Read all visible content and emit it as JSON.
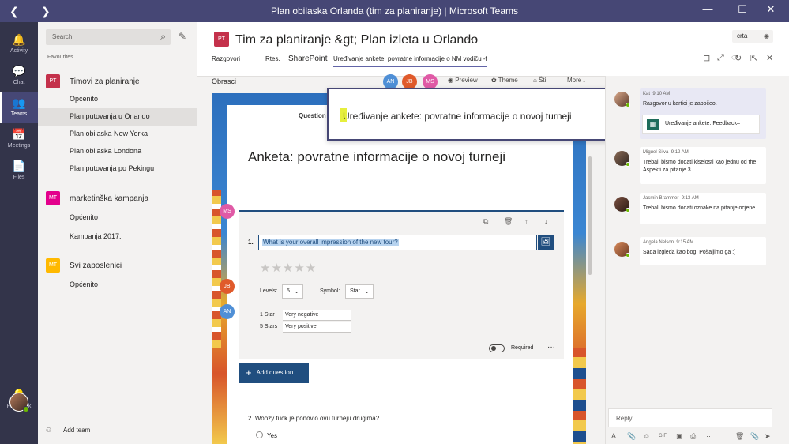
{
  "window": {
    "title": "Plan obilaska Orlanda (tim za planiranje) | Microsoft Teams",
    "back_glyph": "❮",
    "forward_glyph": "❯",
    "minimize": "—",
    "maximize": "☐",
    "close": "✕"
  },
  "rail": [
    {
      "label": "Activity",
      "icon": "bell-icon",
      "glyph": "🔔"
    },
    {
      "label": "Chat",
      "icon": "chat-icon",
      "glyph": "💬"
    },
    {
      "label": "Teams",
      "icon": "teams-icon",
      "glyph": "👥",
      "active": true
    },
    {
      "label": "Meetings",
      "icon": "calendar-icon",
      "glyph": "📅"
    },
    {
      "label": "Files",
      "icon": "files-icon",
      "glyph": "📄"
    },
    {
      "label": "Feedback",
      "icon": "lightbulb-icon",
      "glyph": "💡"
    }
  ],
  "sidebar": {
    "search_placeholder": "Search",
    "search_glyph": "⌕",
    "compose_glyph": "✎",
    "favourites_label": "Favourites",
    "teams": [
      {
        "tile": "PT",
        "color": "#c4314b",
        "name": "Timovi za planiranje",
        "channels": [
          "Općenito",
          "Plan putovanja u Orlando",
          "Plan obilaska New Yorka",
          "Plan obilaska Londona",
          "Plan putovanja po Pekingu"
        ]
      },
      {
        "tile": "MT",
        "color": "#e3008c",
        "name": "marketinška kampanja",
        "channels": [
          "Općenito",
          "Kampanja 2017."
        ]
      },
      {
        "tile": "MT",
        "color": "#ffb900",
        "name": "Svi zaposlenici",
        "channels": [
          "Općenito"
        ]
      }
    ],
    "add_team": "Add team",
    "add_team_glyph": "⚇"
  },
  "header": {
    "tile": "PT",
    "title": "Tim za planiranje &gt; Plan izleta u Orlando",
    "more": "···",
    "org_pill": "crta I",
    "org_glyph": "◉",
    "tabs": [
      "Razgovori",
      "Rtes.",
      "SharePoint",
      "Uređivanje ankete: povratne informacije o NM vodiču -f"
    ],
    "icons": [
      "⊟",
      "⤢",
      "◌",
      "↻",
      "⇱",
      "✕"
    ]
  },
  "forms": {
    "label": "Obrasci",
    "faces": [
      {
        "initials": "AN",
        "color": "#4f8fd6"
      },
      {
        "initials": "JB",
        "color": "#e05a2b"
      },
      {
        "initials": "MS",
        "color": "#e05aa6"
      }
    ],
    "preview": "Preview",
    "theme": "Theme",
    "share": "Šti",
    "more": "More",
    "preview_glyph": "◉",
    "theme_glyph": "✿",
    "share_glyph": "⌂",
    "more_glyph": "⌄",
    "questions_tab": "Question",
    "title": "Anketa: povratne informacije o novoj turneji",
    "side_faces": [
      {
        "initials": "MS",
        "color": "#e05aa6"
      },
      {
        "initials": "JB",
        "color": "#e05a2b"
      },
      {
        "initials": "AN",
        "color": "#4f8fd6"
      }
    ],
    "q1": {
      "number": "1.",
      "text": "What is your overall impression of the new tour?",
      "image_glyph": "🖼",
      "actions": [
        "⧉",
        "🗑",
        "↑",
        "↓"
      ],
      "stars": "★★★★★",
      "levels_label": "Levels:",
      "levels_value": "5",
      "symbol_label": "Symbol:",
      "symbol_value": "Star",
      "chevron": "⌄",
      "rows": [
        {
          "key": "1 Star",
          "value": "Very negative"
        },
        {
          "key": "5 Stars",
          "value": "Very positive"
        }
      ],
      "required_label": "Required",
      "more": "···"
    },
    "add_question": "Add question",
    "add_glyph": "+",
    "q2_text": "2. Woozy tuck je ponovio ovu turneju drugima?",
    "q2_option": "Yes"
  },
  "callout": {
    "text": "Uređivanje ankete: povratne informacije o novoj turneji"
  },
  "chat": {
    "messages": [
      {
        "author": "Kat",
        "time": "9:10 AM",
        "text": "Razgovor u kartici je započeo.",
        "card": "Uređivanje ankete. Feedback–",
        "card_glyph": "▦"
      },
      {
        "author": "Miguel Silva",
        "time": "9:12 AM",
        "text": "Trebali bismo dodati kiselosti kao jednu od the Aspekti za pitanje 3."
      },
      {
        "author": "Jasmin Brammer",
        "time": "9:13 AM",
        "text": "Trebali bismo dodati oznake na pitanje ocjene."
      },
      {
        "author": "Angela Nelson",
        "time": "9:15 AM",
        "text": "Sada izgleda kao bog. Pošaljimo ga     ;)"
      }
    ],
    "reply_placeholder": "Reply",
    "reply_tools": [
      "A",
      "📎",
      "☺",
      "GIF",
      "▣",
      "⎙",
      "···"
    ],
    "reply_tools_right": [
      "🗑",
      "📎",
      "➤"
    ]
  }
}
